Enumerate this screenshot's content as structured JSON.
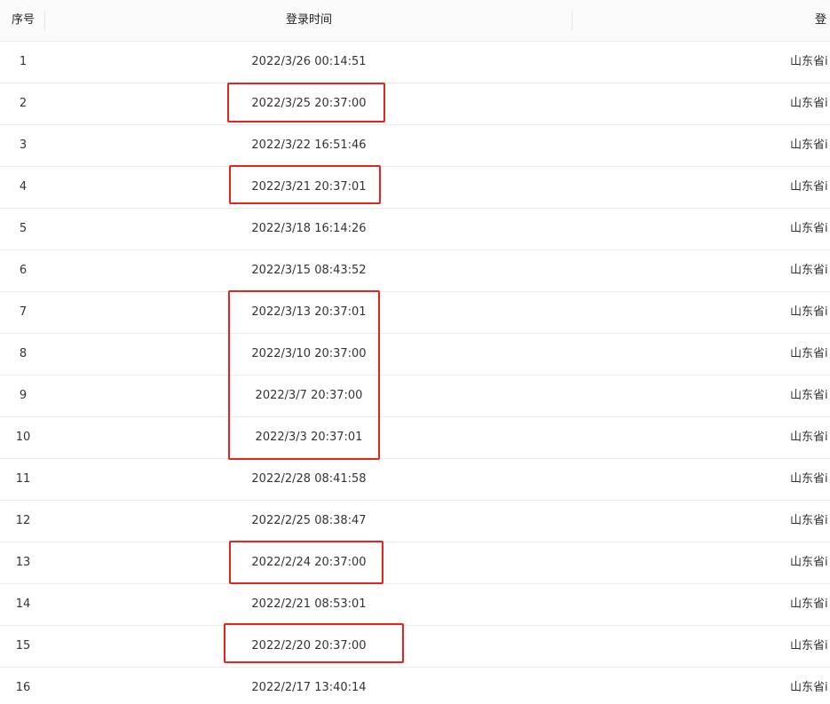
{
  "table": {
    "headers": {
      "index": "序号",
      "time": "登录时间",
      "location": "登"
    },
    "rows": [
      {
        "index": "1",
        "time": "2022/3/26 00:14:51",
        "location": "山东省i"
      },
      {
        "index": "2",
        "time": "2022/3/25 20:37:00",
        "location": "山东省i"
      },
      {
        "index": "3",
        "time": "2022/3/22 16:51:46",
        "location": "山东省i"
      },
      {
        "index": "4",
        "time": "2022/3/21 20:37:01",
        "location": "山东省i"
      },
      {
        "index": "5",
        "time": "2022/3/18 16:14:26",
        "location": "山东省i"
      },
      {
        "index": "6",
        "time": "2022/3/15 08:43:52",
        "location": "山东省i"
      },
      {
        "index": "7",
        "time": "2022/3/13 20:37:01",
        "location": "山东省i"
      },
      {
        "index": "8",
        "time": "2022/3/10 20:37:00",
        "location": "山东省i"
      },
      {
        "index": "9",
        "time": "2022/3/7 20:37:00",
        "location": "山东省i"
      },
      {
        "index": "10",
        "time": "2022/3/3 20:37:01",
        "location": "山东省i"
      },
      {
        "index": "11",
        "time": "2022/2/28 08:41:58",
        "location": "山东省i"
      },
      {
        "index": "12",
        "time": "2022/2/25 08:38:47",
        "location": "山东省i"
      },
      {
        "index": "13",
        "time": "2022/2/24 20:37:00",
        "location": "山东省i"
      },
      {
        "index": "14",
        "time": "2022/2/21 08:53:01",
        "location": "山东省i"
      },
      {
        "index": "15",
        "time": "2022/2/20 20:37:00",
        "location": "山东省i"
      },
      {
        "index": "16",
        "time": "2022/2/17 13:40:14",
        "location": "山东省i"
      }
    ]
  },
  "colors": {
    "highlight": "#e8231d",
    "header_bg": "#fafafa",
    "row_border": "#ececec",
    "text": "#333333"
  }
}
